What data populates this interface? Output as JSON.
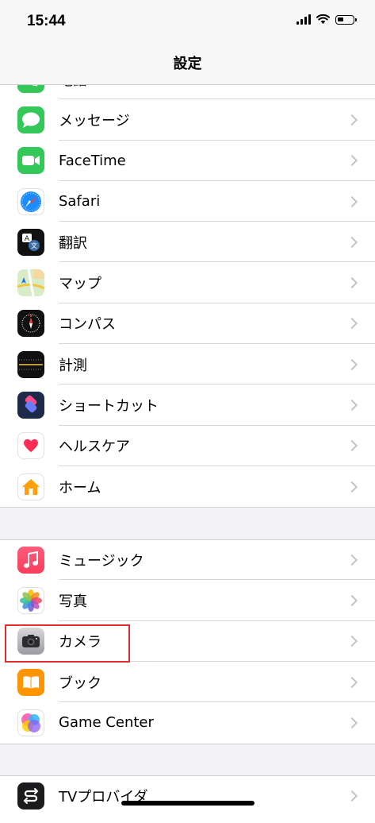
{
  "status_bar": {
    "time": "15:44"
  },
  "nav": {
    "title": "設定"
  },
  "groups": [
    {
      "items": [
        {
          "label": "電話",
          "icon": "phone-icon"
        },
        {
          "label": "メッセージ",
          "icon": "messages-icon"
        },
        {
          "label": "FaceTime",
          "icon": "facetime-icon"
        },
        {
          "label": "Safari",
          "icon": "safari-icon"
        },
        {
          "label": "翻訳",
          "icon": "translate-icon"
        },
        {
          "label": "マップ",
          "icon": "maps-icon"
        },
        {
          "label": "コンパス",
          "icon": "compass-icon"
        },
        {
          "label": "計測",
          "icon": "measure-icon"
        },
        {
          "label": "ショートカット",
          "icon": "shortcuts-icon"
        },
        {
          "label": "ヘルスケア",
          "icon": "health-icon"
        },
        {
          "label": "ホーム",
          "icon": "home-icon"
        }
      ]
    },
    {
      "items": [
        {
          "label": "ミュージック",
          "icon": "music-icon"
        },
        {
          "label": "写真",
          "icon": "photos-icon"
        },
        {
          "label": "カメラ",
          "icon": "camera-icon"
        },
        {
          "label": "ブック",
          "icon": "books-icon"
        },
        {
          "label": "Game Center",
          "icon": "game-center-icon"
        }
      ]
    },
    {
      "items": [
        {
          "label": "TVプロバイダ",
          "icon": "tv-provider-icon"
        }
      ]
    }
  ],
  "highlighted_item": "カメラ",
  "colors": {
    "highlight": "#e03030",
    "background": "#f2f2f7"
  }
}
